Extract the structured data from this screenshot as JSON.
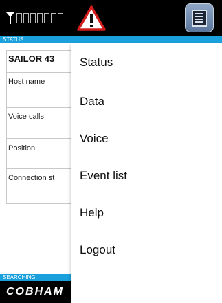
{
  "status_strip": {
    "label": "STATUS"
  },
  "panel": {
    "title": "SAILOR 43",
    "fields": [
      {
        "label": "Host name"
      },
      {
        "label": "Voice calls"
      },
      {
        "label": "Position"
      },
      {
        "label": "Connection st"
      }
    ]
  },
  "bottom": {
    "searching_label": "SEARCHING",
    "logo_text": "COBHAM"
  },
  "menu": {
    "items": [
      {
        "label": "Status"
      },
      {
        "label": "Data"
      },
      {
        "label": "Voice"
      },
      {
        "label": "Event list"
      },
      {
        "label": "Help"
      },
      {
        "label": "Logout"
      }
    ]
  },
  "icons": {
    "antenna": "antenna-icon",
    "warning": "warning-icon",
    "menu": "menu-icon"
  },
  "colors": {
    "topbar": "#000000",
    "status_strip": "#1aa0dc",
    "warning": "#d21c1c",
    "menu_button": "#6b86aa"
  },
  "signal": {
    "bars_total": 7,
    "bars_filled": 0
  }
}
